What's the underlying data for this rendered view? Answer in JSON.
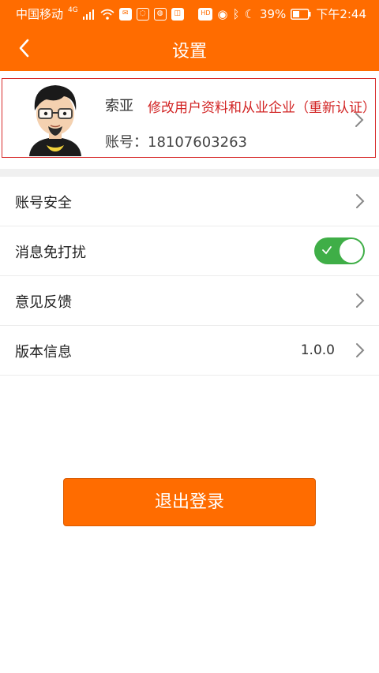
{
  "status_bar": {
    "carrier": "中国移动",
    "network": "4G",
    "battery": "39%",
    "time": "下午2:44",
    "hd_label": "HD"
  },
  "header": {
    "title": "设置"
  },
  "profile": {
    "name": "索亚",
    "edit_note": "修改用户资料和从业企业（重新认证）",
    "account_label": "账号：",
    "account_number": "18107603263"
  },
  "settings": {
    "items": [
      {
        "label": "账号安全"
      },
      {
        "label": "消息免打扰",
        "toggle_on": true
      },
      {
        "label": "意见反馈"
      },
      {
        "label": "版本信息",
        "value": "1.0.0"
      }
    ]
  },
  "logout": {
    "label": "退出登录"
  },
  "colors": {
    "accent": "#ff6c00",
    "toggle_on": "#3fae47",
    "highlight_border": "#d72b2b",
    "highlight_text": "#d22424"
  }
}
